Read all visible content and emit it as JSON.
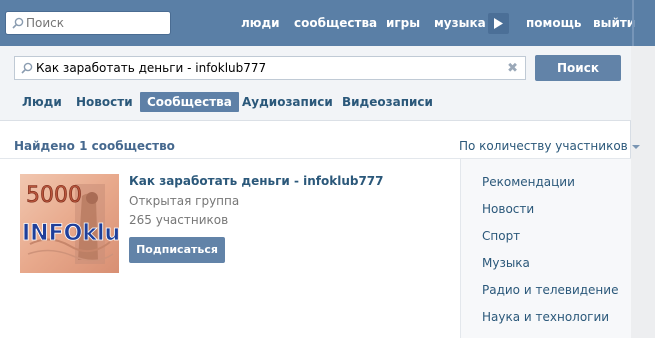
{
  "header": {
    "search_placeholder": "Поиск",
    "nav": [
      "люди",
      "сообщества",
      "игры",
      "музыка",
      "помощь",
      "выйти"
    ]
  },
  "search": {
    "query": "Как заработать деньги - infoklub777",
    "button": "Поиск"
  },
  "tabs": [
    {
      "label": "Люди",
      "active": false
    },
    {
      "label": "Новости",
      "active": false
    },
    {
      "label": "Сообщества",
      "active": true
    },
    {
      "label": "Аудиозаписи",
      "active": false
    },
    {
      "label": "Видеозаписи",
      "active": false
    }
  ],
  "results_header": {
    "found": "Найдено 1 сообщество",
    "sort": "По количеству участников"
  },
  "result": {
    "title": "Как заработать деньги - infoklub777",
    "type": "Открытая группа",
    "members": "265 участников",
    "subscribe": "Подписаться",
    "image_text": {
      "amount": "5000",
      "name": "INFOklub"
    }
  },
  "categories": [
    "Рекомендации",
    "Новости",
    "Спорт",
    "Музыка",
    "Радио и телевидение",
    "Наука и технологии"
  ],
  "colors": {
    "header_bg": "#5a7fa6",
    "button_bg": "#6283a8",
    "link": "#2b587a"
  }
}
